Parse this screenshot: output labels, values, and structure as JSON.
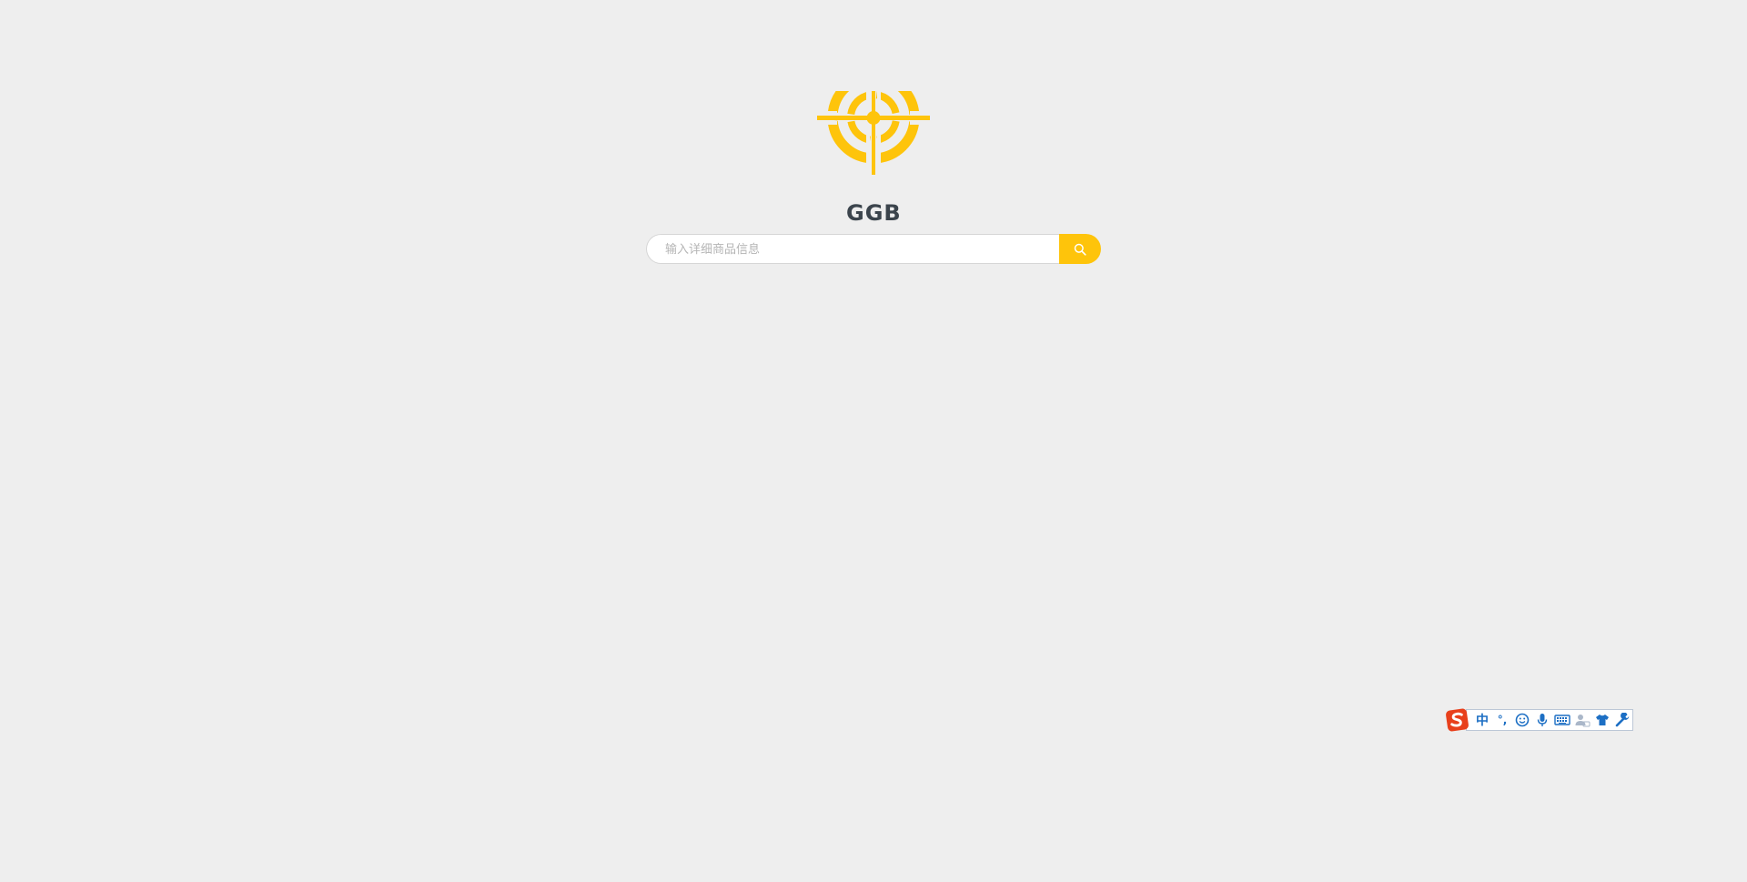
{
  "brand": {
    "logo_icon": "crosshair-target-icon",
    "wordmark": "GGB",
    "accent_color": "#fec40b",
    "wordmark_color": "#3b444c"
  },
  "search": {
    "placeholder": "输入详细商品信息",
    "value": "",
    "button_icon": "search-icon"
  },
  "ime_toolbar": {
    "logo_icon": "sogou-logo-icon",
    "mode_label": "中",
    "punct_label": "°,",
    "items": [
      "emoji-icon",
      "microphone-icon",
      "keyboard-icon",
      "user-icon",
      "skin-shirt-icon",
      "settings-wrench-icon"
    ]
  }
}
